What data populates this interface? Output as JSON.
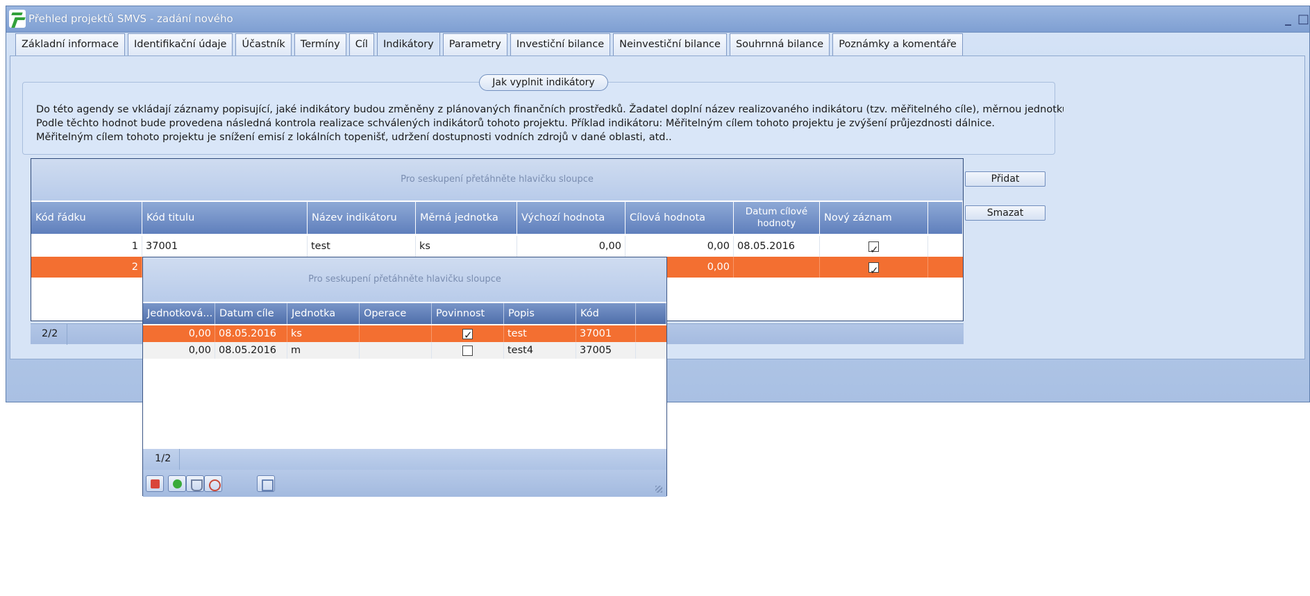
{
  "window": {
    "title": "Přehled projektů SMVS - zadání nového",
    "min": "_",
    "max": "□",
    "close": "×"
  },
  "tabs": [
    "Základní informace",
    "Identifikační údaje",
    "Účastník",
    "Termíny",
    "Cíl",
    "Indikátory",
    "Parametry",
    "Investiční bilance",
    "Neinvestiční bilance",
    "Souhrnná bilance",
    "Poznámky a komentáře"
  ],
  "active_tab": "Indikátory",
  "info": {
    "button": "Jak vyplnit indikátory",
    "line1": "Do této agendy se vkládají záznamy popisující, jaké indikátory budou změněny z plánovaných finančních prostředků. Žadatel doplní název realizovaného indikátoru (tzv. měřitelného cíle), měrnou jednotku, výcl",
    "line2": "Podle těchto hodnot bude provedena následná kontrola realizace schválených indikátorů tohoto projektu. Příklad indikátoru: Měřitelným cílem tohoto projektu je zvýšení průjezdnosti dálnice.",
    "line3": "Měřitelným cílem tohoto projektu je snížení emisí z lokálních topenišť, udržení dostupnosti vodních zdrojů v dané oblasti, atd.."
  },
  "grid": {
    "group_hint": "Pro seskupení přetáhněte hlavičku sloupce",
    "columns": [
      "Kód řádku",
      "Kód titulu",
      "Název indikátoru",
      "Měrná jednotka",
      "Výchozí hodnota",
      "Cílová hodnota",
      "Datum cílové hodnoty",
      "Nový záznam"
    ],
    "rows": [
      {
        "kod_radku": "1",
        "kod_titulu": "37001",
        "nazev": "test",
        "jednotka": "ks",
        "vychozi": "0,00",
        "cilova": "0,00",
        "datum": "08.05.2016",
        "novy": true
      },
      {
        "kod_radku": "2",
        "kod_titulu": "",
        "nazev": "",
        "jednotka": "",
        "vychozi": "",
        "cilova": "0,00",
        "datum": "",
        "novy": true
      }
    ],
    "pager": "2/2"
  },
  "buttons": {
    "add": "Přidat",
    "delete": "Smazat"
  },
  "popup": {
    "group_hint": "Pro seskupení přetáhněte hlavičku sloupce",
    "columns": [
      "Jednotková...",
      "Datum cíle",
      "Jednotka",
      "Operace",
      "Povinnost",
      "Popis",
      "Kód"
    ],
    "rows": [
      {
        "jednotkova": "0,00",
        "datum": "08.05.2016",
        "jednotka": "ks",
        "operace": "",
        "povinnost": true,
        "popis": "test",
        "kod": "37001"
      },
      {
        "jednotkova": "0,00",
        "datum": "08.05.2016",
        "jednotka": "m",
        "operace": "",
        "povinnost": false,
        "popis": "test4",
        "kod": "37005"
      }
    ],
    "pager": "1/2",
    "toolbar": [
      "delete-icon",
      "refresh-icon",
      "filter-icon",
      "clear-filter-icon",
      "columns-icon"
    ]
  },
  "colors": {
    "selection": "#f36f31",
    "header": "#5f7fbc",
    "window": "#b8cdea"
  }
}
